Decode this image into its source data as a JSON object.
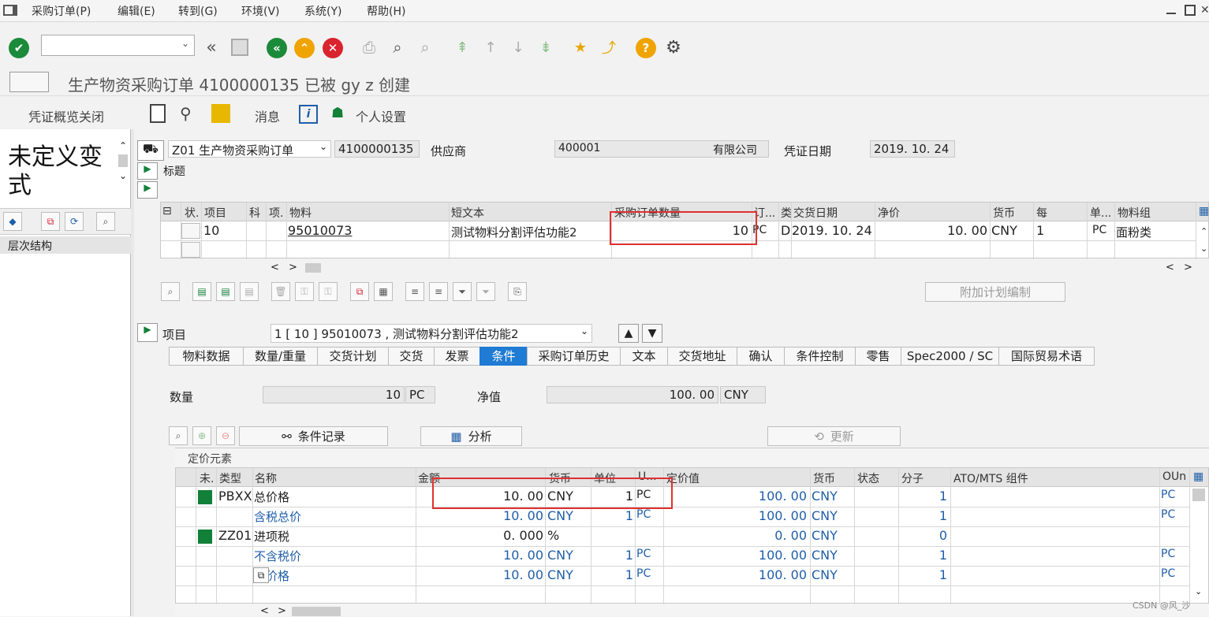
{
  "menu": {
    "items": [
      "采购订单(P)",
      "编辑(E)",
      "转到(G)",
      "环境(V)",
      "系统(Y)",
      "帮助(H)"
    ]
  },
  "title": "生产物资采购订单 4100000135 已被 gy z 创建",
  "app_toolbar": {
    "overview_close": "凭证概览关闭",
    "messages": "消息",
    "personal_settings": "个人设置"
  },
  "left_pane": {
    "variant_text": "未定义变式",
    "hierarchy_label": "层次结构"
  },
  "header": {
    "doc_type": "Z01 生产物资采购订单",
    "po_number": "4100000135",
    "vendor_label": "供应商",
    "vendor_value": "400001",
    "vendor_name": "有限公司",
    "doc_date_label": "凭证日期",
    "doc_date_value": "2019. 10. 24",
    "section_header": "标题"
  },
  "item_grid": {
    "columns": [
      "状.",
      "项目",
      "科",
      "项.",
      "物料",
      "短文本",
      "采购订单数量",
      "订...",
      "类",
      "交货日期",
      "净价",
      "货币",
      "每",
      "单...",
      "物料组"
    ],
    "rows": [
      {
        "item": "10",
        "material": "95010073",
        "short_text": "测试物料分割评估功能2",
        "qty": "10",
        "unit": "PC",
        "cat": "D",
        "delivery_date": "2019. 10. 24",
        "net_price": "10. 00",
        "currency": "CNY",
        "per": "1",
        "uom": "PC",
        "mat_group": "面粉类"
      }
    ]
  },
  "plan_button": "附加计划编制",
  "item_detail": {
    "label": "项目",
    "selected": "1 [ 10 ] 95010073 , 测试物料分割评估功能2"
  },
  "tabs": [
    "物料数据",
    "数量/重量",
    "交货计划",
    "交货",
    "发票",
    "条件",
    "采购订单历史",
    "文本",
    "交货地址",
    "确认",
    "条件控制",
    "零售",
    "Spec2000 / SC",
    "国际贸易术语"
  ],
  "active_tab": "条件",
  "conditions": {
    "qty_label": "数量",
    "qty_value": "10",
    "qty_unit": "PC",
    "net_label": "净值",
    "net_value": "100. 00",
    "net_currency": "CNY",
    "cond_record_btn": "条件记录",
    "analysis_btn": "分析",
    "update_btn": "更新",
    "pricing_elements": "定价元素",
    "columns": [
      "未.",
      "类型",
      "名称",
      "金额",
      "货币",
      "单位",
      "U...",
      "定价值",
      "货币",
      "状态",
      "分子",
      "ATO/MTS 组件",
      "OUn"
    ],
    "rows": [
      {
        "type": "PBXX",
        "name": "总价格",
        "amount": "10. 00",
        "curr": "CNY",
        "per": "1",
        "uom": "PC",
        "value": "100. 00",
        "vcurr": "CNY",
        "num": "1",
        "oun": "PC",
        "green": true,
        "blue": false
      },
      {
        "type": "",
        "name": "含税总价",
        "amount": "10. 00",
        "curr": "CNY",
        "per": "1",
        "uom": "PC",
        "value": "100. 00",
        "vcurr": "CNY",
        "num": "1",
        "oun": "PC",
        "green": false,
        "blue": true
      },
      {
        "type": "ZZ01",
        "name": "进项税",
        "amount": "0. 000",
        "curr": "%",
        "per": "",
        "uom": "",
        "value": "0. 00",
        "vcurr": "CNY",
        "num": "0",
        "oun": "",
        "green": true,
        "blue": false
      },
      {
        "type": "",
        "name": "不含税价",
        "amount": "10. 00",
        "curr": "CNY",
        "per": "1",
        "uom": "PC",
        "value": "100. 00",
        "vcurr": "CNY",
        "num": "1",
        "oun": "PC",
        "green": false,
        "blue": true
      },
      {
        "type": "",
        "name": "际价格",
        "amount": "10. 00",
        "curr": "CNY",
        "per": "1",
        "uom": "PC",
        "value": "100. 00",
        "vcurr": "CNY",
        "num": "1",
        "oun": "PC",
        "green": false,
        "blue": true
      }
    ]
  },
  "watermark": "CSDN @风_沙",
  "colors": {
    "accent": "#1f7bd4",
    "status_green": "#128038",
    "highlight_red": "#e03030",
    "link_blue": "#1f5ea8"
  }
}
